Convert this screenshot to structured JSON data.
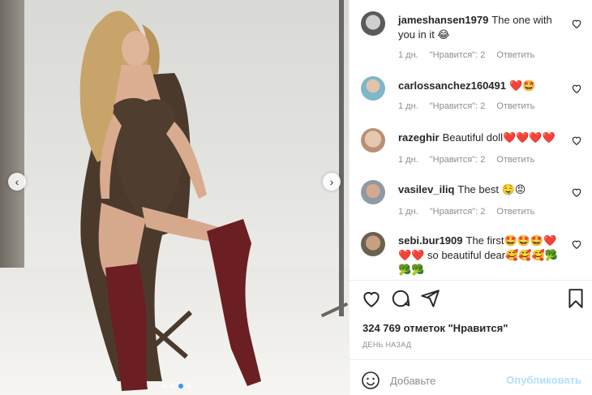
{
  "post": {
    "image_alt": "Woman in brown bodysuit and trench coat with burgundy knee-high boots sitting on a stool in a photo studio",
    "carousel_dots": 4,
    "carousel_active": 3
  },
  "comments": [
    {
      "username": "jameshansen1979",
      "text": "The one with you in it 😂",
      "time": "1 дн.",
      "likes": "\"Нравится\": 2",
      "reply": "Ответить"
    },
    {
      "username": "carlossanchez160491",
      "text": "❤️🤩",
      "time": "1 дн.",
      "likes": "\"Нравится\": 2",
      "reply": "Ответить"
    },
    {
      "username": "razeghir",
      "text": "Beautiful doll❤️❤️❤️❤️",
      "time": "1 дн.",
      "likes": "\"Нравится\": 2",
      "reply": "Ответить"
    },
    {
      "username": "vasilev_iliq",
      "text": "The best 🤤😡",
      "time": "1 дн.",
      "likes": "\"Нравится\": 2",
      "reply": "Ответить"
    },
    {
      "username": "sebi.bur1909",
      "text": "The first🤩🤩🤩❤️❤️❤️ so beautiful dear🥰🥰🥰🥦🥦🥦",
      "time": "",
      "likes": "",
      "reply": ""
    }
  ],
  "stats": {
    "likes": "324 769 отметок \"Нравится\"",
    "time": "ДЕНЬ НАЗАД"
  },
  "add_comment": {
    "placeholder": "Добавьте",
    "publish": "Опубликовать"
  },
  "colors": {
    "accent": "#3897f0",
    "publish_disabled": "#b2dffc",
    "like_red": "#ed4956",
    "meta_gray": "#8e8e8e"
  }
}
